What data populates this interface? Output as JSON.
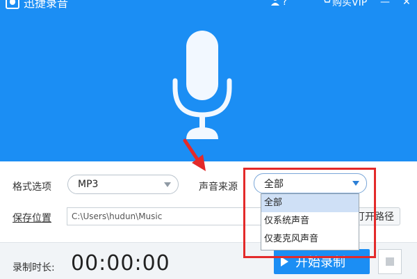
{
  "app": {
    "title": "迅捷录音"
  },
  "topbar": {
    "user_icon": "user-icon",
    "help_label": "?",
    "vip_label": "购买VIP",
    "minimize": "—",
    "close": "✕"
  },
  "format": {
    "label": "格式选项",
    "value": "MP3"
  },
  "source": {
    "label": "声音来源",
    "value": "全部",
    "options": [
      "全部",
      "仅系统声音",
      "仅麦克风声音"
    ]
  },
  "save": {
    "label": "保存位置",
    "path": "C:\\Users\\hudun\\Music",
    "open_label": "打开路径"
  },
  "record": {
    "duration_label": "录制时长:",
    "duration": "00:00:00",
    "start_label": "开始录制"
  },
  "colors": {
    "accent": "#1b8ef4",
    "highlight": "#e32a2a",
    "selected": "#cfe0f6"
  }
}
